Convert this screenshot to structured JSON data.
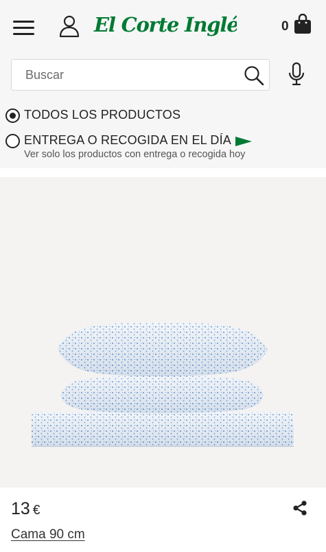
{
  "header": {
    "logo_text": "El Corte Inglés",
    "logo_color": "#007a33",
    "cart_count": "0",
    "menu_icon": "hamburger-menu-icon",
    "user_icon": "user-icon",
    "cart_icon": "shopping-bag-icon"
  },
  "search": {
    "placeholder": "Buscar",
    "value": "",
    "icon": "search-icon",
    "mic_icon": "microphone-icon"
  },
  "filters": {
    "options": [
      {
        "label": "TODOS LOS PRODUCTOS",
        "selected": true
      },
      {
        "label": "ENTREGA O RECOGIDA EN EL DÍA",
        "selected": false,
        "sublabel": "Ver solo los productos con entrega o recogida hoy",
        "flag_color": "#007a33"
      }
    ]
  },
  "product": {
    "price_value": "13",
    "price_currency": "€",
    "name": "Cama 90 cm",
    "image_description_colors": {
      "background": "#f4f3f1",
      "fabric": "#eef2f8",
      "dots": "#5b8fc7"
    },
    "share_icon": "share-icon"
  }
}
